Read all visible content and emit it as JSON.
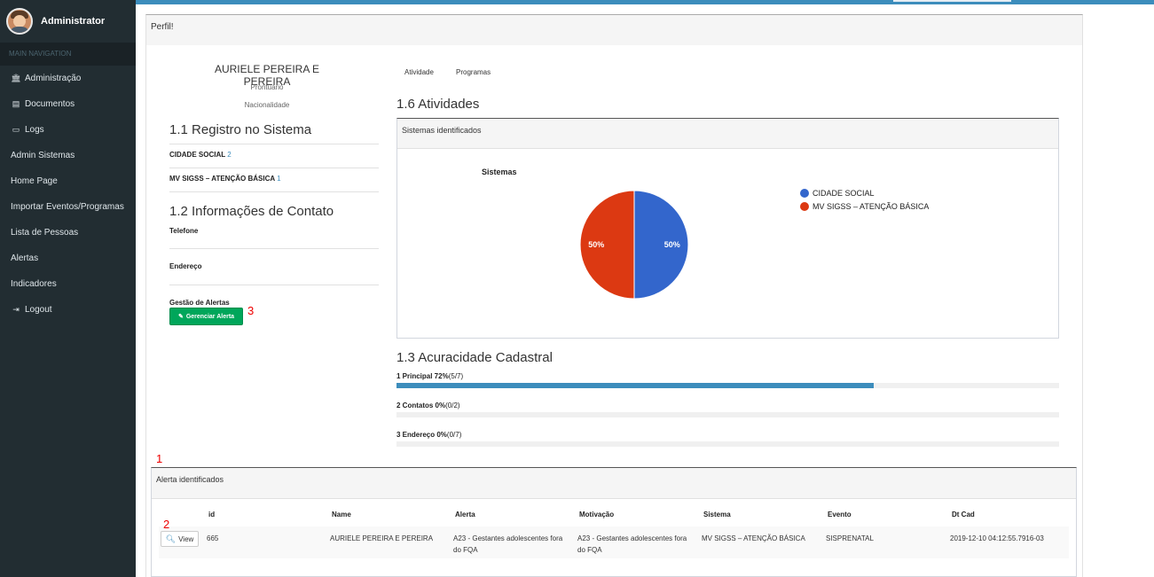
{
  "sidebar": {
    "user": "Administrator",
    "header": "MAIN NAVIGATION",
    "items": [
      {
        "icon": "bank-icon",
        "glyph": "🏛",
        "label": "Administração"
      },
      {
        "icon": "document-icon",
        "glyph": "▤",
        "label": "Documentos"
      },
      {
        "icon": "desktop-icon",
        "glyph": "▭",
        "label": "Logs"
      },
      {
        "icon": "",
        "glyph": "",
        "label": "Admin Sistemas"
      },
      {
        "icon": "",
        "glyph": "",
        "label": "Home Page"
      },
      {
        "icon": "",
        "glyph": "",
        "label": "Importar Eventos/Programas"
      },
      {
        "icon": "",
        "glyph": "",
        "label": "Lista de Pessoas"
      },
      {
        "icon": "",
        "glyph": "",
        "label": "Alertas"
      },
      {
        "icon": "",
        "glyph": "",
        "label": "Indicadores"
      },
      {
        "icon": "logout-icon",
        "glyph": "⇥",
        "label": "Logout"
      }
    ]
  },
  "page": {
    "title": "Perfil!"
  },
  "profile": {
    "name": "AURIELE PEREIRA E PEREIRA",
    "prontuario": "Prontuário",
    "nacionalidade": "Nacionalidade",
    "registro_title": "1.1 Registro no Sistema",
    "registros": [
      {
        "sistema": "CIDADE SOCIAL",
        "count": "2"
      },
      {
        "sistema": "MV SIGSS – ATENÇÃO BÁSICA",
        "count": "1"
      }
    ],
    "contato_title": "1.2 Informações de Contato",
    "telefone_label": "Telefone",
    "endereco_label": "Endereço",
    "gestao_label": "Gestão de Alertas",
    "gerenciar_button": "Gerenciar Alerta",
    "annotation_3": "3"
  },
  "tabs": [
    "Atividade",
    "Programas"
  ],
  "atividades": {
    "title": "1.6 Atividades",
    "box_title": "Sistemas identificados"
  },
  "chart_data": {
    "type": "pie",
    "title": "Sistemas",
    "labels": [
      "CIDADE SOCIAL",
      "MV SIGSS – ATENÇÃO BÁSICA"
    ],
    "values": [
      50,
      50
    ],
    "value_labels": [
      "50%",
      "50%"
    ],
    "colors": [
      "#3366cc",
      "#dc3912"
    ],
    "legend_position": "right"
  },
  "acuracidade": {
    "title": "1.3 Acuracidade Cadastral",
    "bars": [
      {
        "label_bold": "1 Principal 72%",
        "label_rest": "(5/7)",
        "percent": 72
      },
      {
        "label_bold": "2 Contatos 0%",
        "label_rest": "(0/2)",
        "percent": 0
      },
      {
        "label_bold": "3 Endereço 0%",
        "label_rest": "(0/7)",
        "percent": 0
      }
    ]
  },
  "alertas": {
    "annotation_1": "1",
    "annotation_2": "2",
    "box_title": "Alerta identificados",
    "columns": [
      "id",
      "Name",
      "Alerta",
      "Motivação",
      "Sistema",
      "Evento",
      "Dt Cad"
    ],
    "view_button": "View",
    "rows": [
      {
        "id": "665",
        "name": "AURIELE PEREIRA E PEREIRA",
        "alerta": "A23 - Gestantes adolescentes fora do FQA",
        "motivacao": "A23 - Gestantes adolescentes fora do FQA",
        "sistema": "MV SIGSS – ATENÇÃO BÁSICA",
        "evento": "SISPRENATAL",
        "dtcad": "2019-12-10 04:12:55.7916-03"
      }
    ]
  }
}
